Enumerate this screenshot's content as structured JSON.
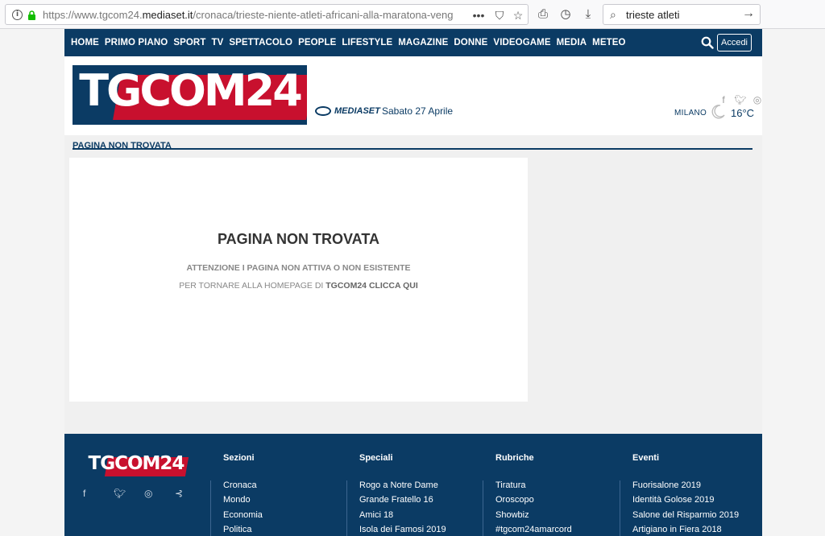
{
  "browser": {
    "url_prefix": "https://www.tgcom24.",
    "url_domain": "mediaset.it",
    "url_path": "/cronaca/trieste-niente-atleti-africani-alla-maratona-veng",
    "search_value": "trieste atleti"
  },
  "nav": {
    "items": [
      "HOME",
      "PRIMO PIANO",
      "SPORT",
      "TV",
      "SPETTACOLO",
      "PEOPLE",
      "LIFESTYLE",
      "MAGAZINE",
      "DONNE",
      "VIDEOGAME",
      "MEDIA",
      "METEO"
    ],
    "login": "Accedi"
  },
  "header": {
    "logo_text": "TGCOM24",
    "mediaset": "MEDIASET",
    "date": "Sabato 27 Aprile",
    "city": "MILANO",
    "temperature": "16°C"
  },
  "breadcrumb": "PAGINA NON TROVATA",
  "error": {
    "title": "PAGINA NON TROVATA",
    "line1": "ATTENZIONE I PAGINA NON ATTIVA O NON ESISTENTE",
    "line2_prefix": "PER TORNARE ALLA HOMEPAGE DI",
    "line2_link": "TGCOM24 CLICCA QUI"
  },
  "footer": {
    "logo_text": "TGCOM24",
    "columns": [
      {
        "title": "Sezioni",
        "items": [
          "Cronaca",
          "Mondo",
          "Economia",
          "Politica"
        ]
      },
      {
        "title": "Speciali",
        "items": [
          "Rogo a Notre Dame",
          "Grande Fratello 16",
          "Amici 18",
          "Isola dei Famosi 2019"
        ]
      },
      {
        "title": "Rubriche",
        "items": [
          "Tiratura",
          "Oroscopo",
          "Showbiz",
          "#tgcom24amarcord"
        ]
      },
      {
        "title": "Eventi",
        "items": [
          "Fuorisalone 2019",
          "Identità Golose 2019",
          "Salone del Risparmio 2019",
          "Artigiano in Fiera 2018"
        ]
      }
    ]
  },
  "colors": {
    "brand_blue": "#0b3b64",
    "brand_red": "#c8102e"
  }
}
